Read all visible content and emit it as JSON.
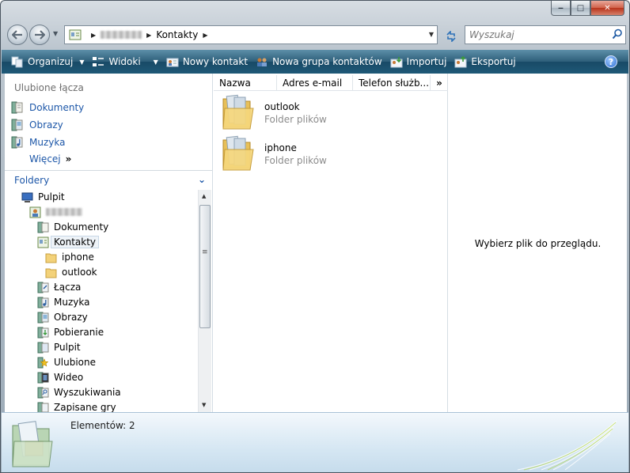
{
  "window": {
    "caption_buttons": {
      "minimize": "‒",
      "maximize": "□",
      "close": "✕"
    }
  },
  "address": {
    "path": [
      "Kontakty"
    ]
  },
  "search": {
    "placeholder": "Wyszukaj"
  },
  "toolbar": {
    "organize": "Organizuj",
    "views": "Widoki",
    "new_contact": "Nowy kontakt",
    "new_group": "Nowa grupa kontaktów",
    "import": "Importuj",
    "export": "Eksportuj",
    "help": "?"
  },
  "nav": {
    "favorites_header": "Ulubione łącza",
    "favorites": [
      "Dokumenty",
      "Obrazy",
      "Muzyka"
    ],
    "more": "Więcej",
    "folders_header": "Foldery",
    "tree": [
      {
        "label": "Pulpit",
        "icon": "desktop-icon"
      },
      {
        "label": "",
        "icon": "user-folder-icon"
      },
      {
        "label": "Dokumenty",
        "icon": "documents-icon"
      },
      {
        "label": "Kontakty",
        "icon": "contacts-icon",
        "selected": true
      },
      {
        "label": "iphone",
        "icon": "folder-icon"
      },
      {
        "label": "outlook",
        "icon": "folder-icon"
      },
      {
        "label": "Łącza",
        "icon": "links-icon"
      },
      {
        "label": "Muzyka",
        "icon": "music-icon"
      },
      {
        "label": "Obrazy",
        "icon": "pictures-icon"
      },
      {
        "label": "Pobieranie",
        "icon": "downloads-icon"
      },
      {
        "label": "Pulpit",
        "icon": "desktop-folder-icon"
      },
      {
        "label": "Ulubione",
        "icon": "favorites-icon"
      },
      {
        "label": "Wideo",
        "icon": "video-icon"
      },
      {
        "label": "Wyszukiwania",
        "icon": "searches-icon"
      },
      {
        "label": "Zapisane gry",
        "icon": "saved-games-icon"
      }
    ]
  },
  "file_list": {
    "columns": [
      "Nazwa",
      "Adres e-mail",
      "Telefon służb...",
      "»"
    ],
    "items": [
      {
        "name": "outlook",
        "type": "Folder plików"
      },
      {
        "name": "iphone",
        "type": "Folder plików"
      }
    ]
  },
  "preview": {
    "message": "Wybierz plik do przeglądu."
  },
  "details": {
    "count_text": "Elementów: 2"
  },
  "colors": {
    "toolbar": "#1f5978",
    "link_blue": "#1d57a8",
    "details_bg": "#d6e7f3"
  }
}
